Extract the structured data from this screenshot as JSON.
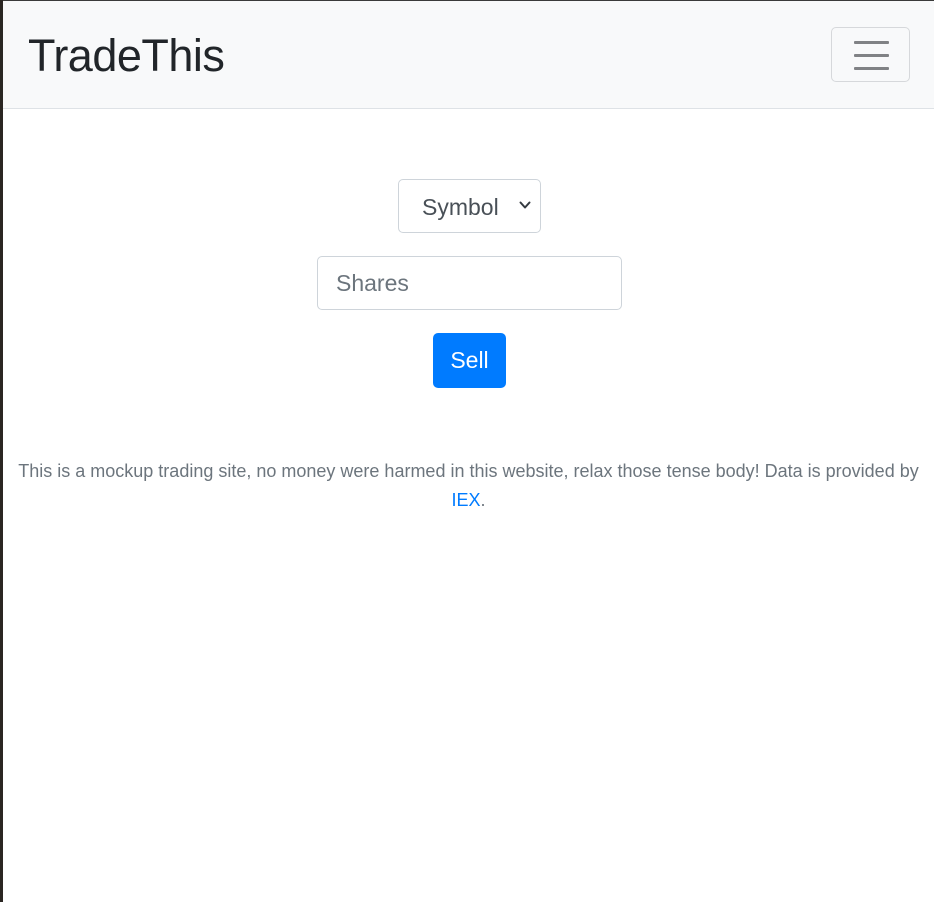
{
  "navbar": {
    "brand": "TradeThis",
    "menu_toggle_icon": "hamburger-menu-icon"
  },
  "form": {
    "symbol_select": {
      "selected": "Symbol",
      "icon": "chevron-down-icon"
    },
    "shares_input": {
      "placeholder": "Shares",
      "value": ""
    },
    "submit_label": "Sell"
  },
  "footer": {
    "text": "This is a mockup trading site, no money were harmed in this website, relax those tense body! Data is provided by",
    "link_label": "IEX",
    "period": "."
  },
  "colors": {
    "navbar_bg": "#f8f9fa",
    "primary": "#007bff",
    "muted_text": "#6c757d"
  }
}
